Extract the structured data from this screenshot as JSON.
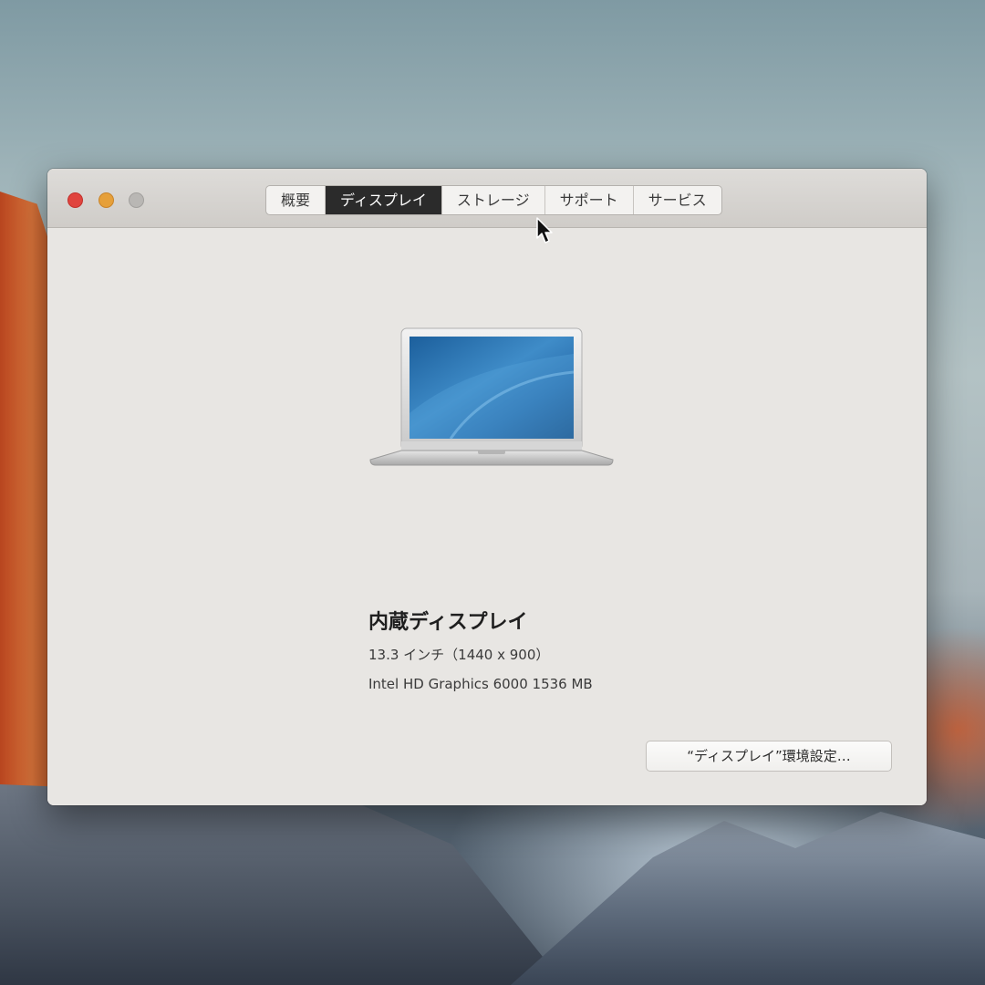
{
  "window": {
    "tabs": [
      {
        "label": "概要",
        "active": false
      },
      {
        "label": "ディスプレイ",
        "active": true
      },
      {
        "label": "ストレージ",
        "active": false
      },
      {
        "label": "サポート",
        "active": false
      },
      {
        "label": "サービス",
        "active": false
      }
    ]
  },
  "display": {
    "title": "内蔵ディスプレイ",
    "size": "13.3 インチ（1440 x 900）",
    "graphics": "Intel HD Graphics 6000 1536 MB",
    "prefs_button_label": "“ディスプレイ”環境設定…"
  },
  "icons": {
    "close": "close-button-icon",
    "minimize": "minimize-button-icon",
    "zoom": "zoom-button-icon",
    "laptop": "macbook-air-icon",
    "cursor": "mouse-pointer-icon"
  },
  "colors": {
    "close": "#e0443e",
    "minimize": "#e6a03a",
    "zoom_disabled": "#b9b7b4",
    "active_tab": "#2b2b2b"
  }
}
